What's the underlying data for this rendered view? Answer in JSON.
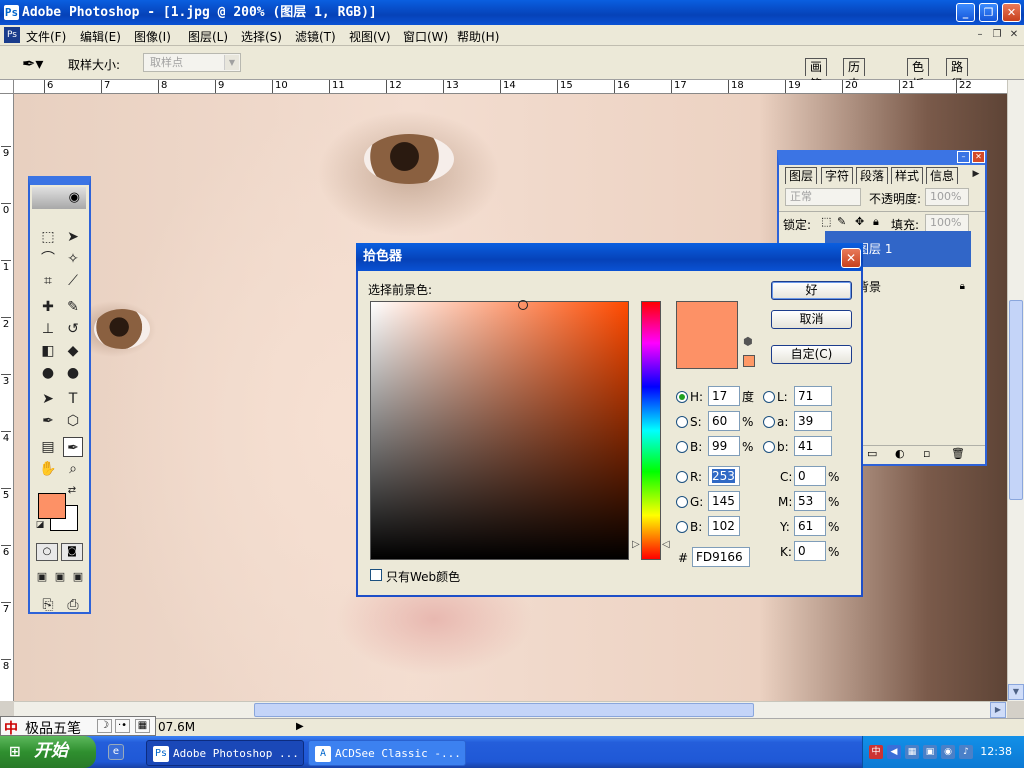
{
  "window": {
    "title": "Adobe Photoshop - [1.jpg @ 200% (图层 1, RGB)]",
    "app_icon": "photoshop-icon"
  },
  "menu": {
    "items": [
      "文件(F)",
      "编辑(E)",
      "图像(I)",
      "图层(L)",
      "选择(S)",
      "滤镜(T)",
      "视图(V)",
      "窗口(W)",
      "帮助(H)"
    ]
  },
  "options": {
    "sample_size_label": "取样大小:",
    "sample_size_value": "取样点"
  },
  "palette_tabs": [
    "画笔",
    "历史记录",
    "色板",
    "路径"
  ],
  "rulers": {
    "h": [
      "6",
      "7",
      "8",
      "9",
      "10",
      "11",
      "12",
      "13",
      "14",
      "15",
      "16",
      "17",
      "18",
      "19",
      "20",
      "21",
      "22"
    ],
    "v": [
      "9",
      "0",
      "1",
      "2",
      "3",
      "4",
      "5",
      "6",
      "7",
      "8"
    ]
  },
  "layers_panel": {
    "tabs": [
      "图层",
      "字符",
      "段落",
      "样式",
      "信息"
    ],
    "blend_mode": "正常",
    "opacity_label": "不透明度:",
    "opacity_value": "100%",
    "lock_label": "锁定:",
    "fill_label": "填充:",
    "fill_value": "100%",
    "layer1_name": "图层 1",
    "background_name": "背景"
  },
  "color_picker": {
    "title": "拾色器",
    "prompt": "选择前景色:",
    "ok_label": "好",
    "cancel_label": "取消",
    "custom_label": "自定(C)",
    "hsb": {
      "H": "17",
      "S": "60",
      "B": "99"
    },
    "hsb_labels": {
      "H": "H:",
      "S": "S:",
      "B": "B:"
    },
    "hsb_units": {
      "H": "度",
      "S": "%",
      "B": "%"
    },
    "lab": {
      "L": "71",
      "a": "39",
      "b": "41"
    },
    "lab_labels": {
      "L": "L:",
      "a": "a:",
      "b": "b:"
    },
    "rgb": {
      "R": "253",
      "G": "145",
      "B": "102"
    },
    "rgb_labels": {
      "R": "R:",
      "G": "G:",
      "B": "B:"
    },
    "cmyk": {
      "C": "0",
      "M": "53",
      "Y": "61",
      "K": "0"
    },
    "cmyk_labels": {
      "C": "C:",
      "M": "M:",
      "Y": "Y:",
      "K": "K:"
    },
    "cmyk_unit": "%",
    "hex_label": "#",
    "hex": "FD9166",
    "web_only_label": "只有Web颜色",
    "current_color": "#fd9166"
  },
  "status": {
    "ime_name": "极品五笔",
    "doc_size": "07.6M"
  },
  "taskbar": {
    "start_label": "开始",
    "items": [
      "Adobe Photoshop ...",
      "ACDSee Classic -..."
    ],
    "clock": "12:38"
  },
  "colors": {
    "foreground": "#fd9166",
    "background": "#ffffff",
    "xp_blue": "#0a52d4"
  }
}
